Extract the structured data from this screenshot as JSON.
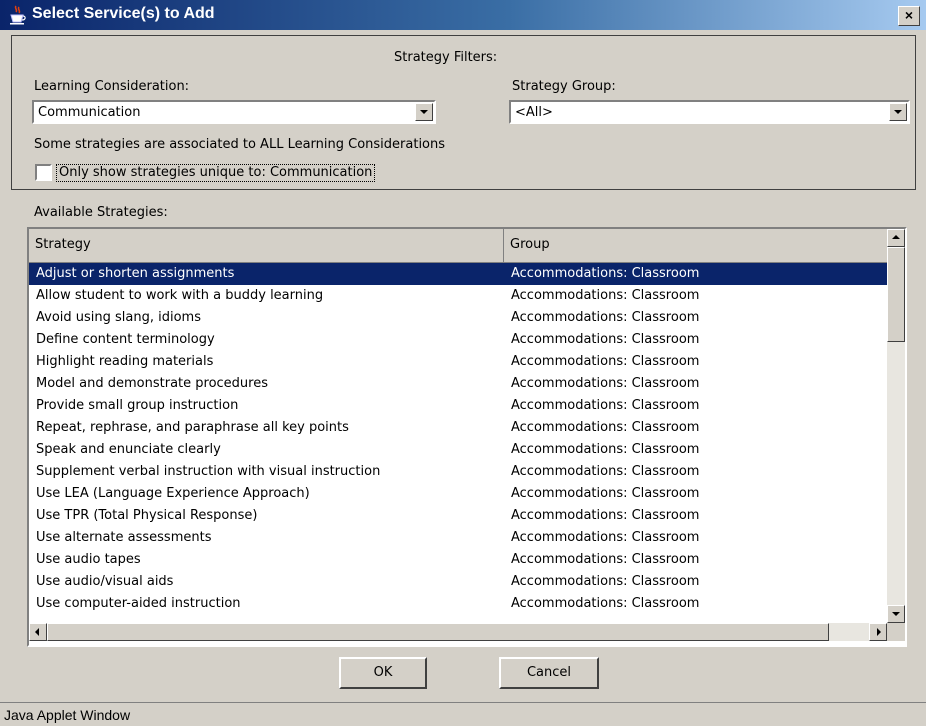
{
  "window": {
    "title": "Select Service(s) to Add",
    "close_label": "×",
    "icon": "java-cup-icon"
  },
  "filters": {
    "legend": "Strategy Filters:",
    "learning_consideration": {
      "label": "Learning Consideration:",
      "value": "Communication"
    },
    "strategy_group": {
      "label": "Strategy Group:",
      "value": "<All>"
    },
    "note": "Some strategies are associated to ALL Learning Considerations",
    "unique_checkbox": {
      "label": "Only show strategies unique to: Communication",
      "checked": false
    }
  },
  "strategies": {
    "label": "Available Strategies:",
    "columns": [
      "Strategy",
      "Group"
    ],
    "selected_index": 0,
    "rows": [
      {
        "strategy": "Adjust or shorten assignments",
        "group": "Accommodations: Classroom"
      },
      {
        "strategy": "Allow student to work with a buddy learning",
        "group": "Accommodations: Classroom"
      },
      {
        "strategy": "Avoid using slang, idioms",
        "group": "Accommodations: Classroom"
      },
      {
        "strategy": "Define content terminology",
        "group": "Accommodations: Classroom"
      },
      {
        "strategy": "Highlight reading materials",
        "group": "Accommodations: Classroom"
      },
      {
        "strategy": "Model and demonstrate procedures",
        "group": "Accommodations: Classroom"
      },
      {
        "strategy": "Provide small group instruction",
        "group": "Accommodations: Classroom"
      },
      {
        "strategy": "Repeat, rephrase, and paraphrase all key points",
        "group": "Accommodations: Classroom"
      },
      {
        "strategy": "Speak and enunciate clearly",
        "group": "Accommodations: Classroom"
      },
      {
        "strategy": "Supplement verbal instruction with visual instruction",
        "group": "Accommodations: Classroom"
      },
      {
        "strategy": "Use LEA (Language Experience Approach)",
        "group": "Accommodations: Classroom"
      },
      {
        "strategy": "Use TPR (Total Physical Response)",
        "group": "Accommodations: Classroom"
      },
      {
        "strategy": "Use alternate assessments",
        "group": "Accommodations: Classroom"
      },
      {
        "strategy": "Use audio tapes",
        "group": "Accommodations: Classroom"
      },
      {
        "strategy": "Use audio/visual aids",
        "group": "Accommodations: Classroom"
      },
      {
        "strategy": "Use computer-aided instruction",
        "group": "Accommodations: Classroom"
      }
    ]
  },
  "buttons": {
    "ok": "OK",
    "cancel": "Cancel"
  },
  "status": "Java Applet Window",
  "colors": {
    "title_gradient_start": "#0a246a",
    "title_gradient_end": "#a6caf0",
    "selection": "#0a246a",
    "face": "#d4d0c8"
  }
}
